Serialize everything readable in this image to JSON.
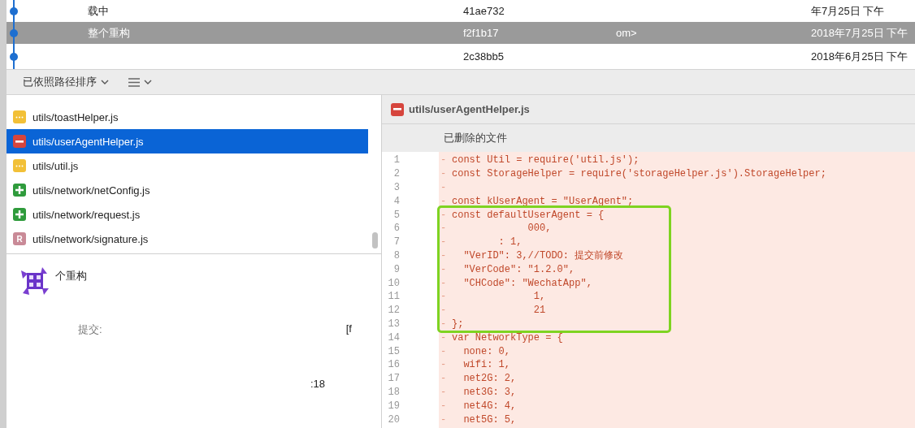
{
  "commits": [
    {
      "message": "载中",
      "hash": "41ae732",
      "date": "年7月25日 下午",
      "selected": false
    },
    {
      "message": "整个重构",
      "author": "om>",
      "hash": "f2f1b17",
      "date": "2018年7月25日 下午",
      "selected": true
    },
    {
      "hash": "2c38bb5",
      "date": "2018年6月25日 下午",
      "selected": false
    }
  ],
  "toolbar": {
    "sort_label": "已依照路径排序"
  },
  "files": [
    {
      "path": "utils/toastHelper.js",
      "kind": "modified",
      "selected": false
    },
    {
      "path": "utils/userAgentHelper.js",
      "kind": "removed",
      "selected": true
    },
    {
      "path": "utils/util.js",
      "kind": "modified",
      "selected": false
    },
    {
      "path": "utils/network/netConfig.js",
      "kind": "added",
      "selected": false
    },
    {
      "path": "utils/network/request.js",
      "kind": "added",
      "selected": false
    },
    {
      "path": "utils/network/signature.js",
      "kind": "renamed",
      "badge": "R",
      "selected": false
    }
  ],
  "details": {
    "message": "个重构",
    "commit_label": "提交:",
    "commit_value": "[f",
    "time_fragment": ":18"
  },
  "diff": {
    "file": "utils/userAgentHelper.js",
    "kind": "removed",
    "subtitle": "已删除的文件",
    "blocks": [
      {
        "lines": [
          {
            "n": "1",
            "sign": "-",
            "code": "const Util = require('util.js');"
          },
          {
            "n": "2",
            "sign": "-",
            "code": "const StorageHelper = require('storageHelper.js').StorageHelper;"
          },
          {
            "n": "3",
            "sign": "-"
          },
          {
            "n": "4",
            "sign": "-",
            "code": "const kUserAgent = \"UserAgent\";"
          }
        ]
      },
      {
        "highlighted": true,
        "lines": [
          {
            "n": "5",
            "sign": "-",
            "code": "const defaultUserAgent = {"
          },
          {
            "n": "6",
            "sign": "-",
            "code": "             000,"
          },
          {
            "n": "7",
            "sign": "-",
            "code": "        : 1,"
          },
          {
            "n": "8",
            "sign": "-",
            "code": "  \"VerID\": 3,//TODO: 提交前修改"
          },
          {
            "n": "9",
            "sign": "-",
            "code": "  \"VerCode\": \"1.2.0\","
          },
          {
            "n": "10",
            "sign": "-",
            "code": "  \"CHCode\": \"WechatApp\","
          },
          {
            "n": "11",
            "sign": "-",
            "code": "              1,"
          },
          {
            "n": "12",
            "sign": "-",
            "code": "              21"
          },
          {
            "n": "13",
            "sign": "-",
            "code": "};"
          }
        ]
      },
      {
        "lines": [
          {
            "n": "14",
            "sign": "-",
            "code": "var NetworkType = {"
          },
          {
            "n": "15",
            "sign": "-",
            "code": "  none: 0,"
          },
          {
            "n": "16",
            "sign": "-",
            "code": "  wifi: 1,"
          },
          {
            "n": "17",
            "sign": "-",
            "code": "  net2G: 2,"
          },
          {
            "n": "18",
            "sign": "-",
            "code": "  net3G: 3,"
          },
          {
            "n": "19",
            "sign": "-",
            "code": "  net4G: 4,"
          },
          {
            "n": "20",
            "sign": "-",
            "code": "  net5G: 5,"
          }
        ]
      }
    ]
  }
}
